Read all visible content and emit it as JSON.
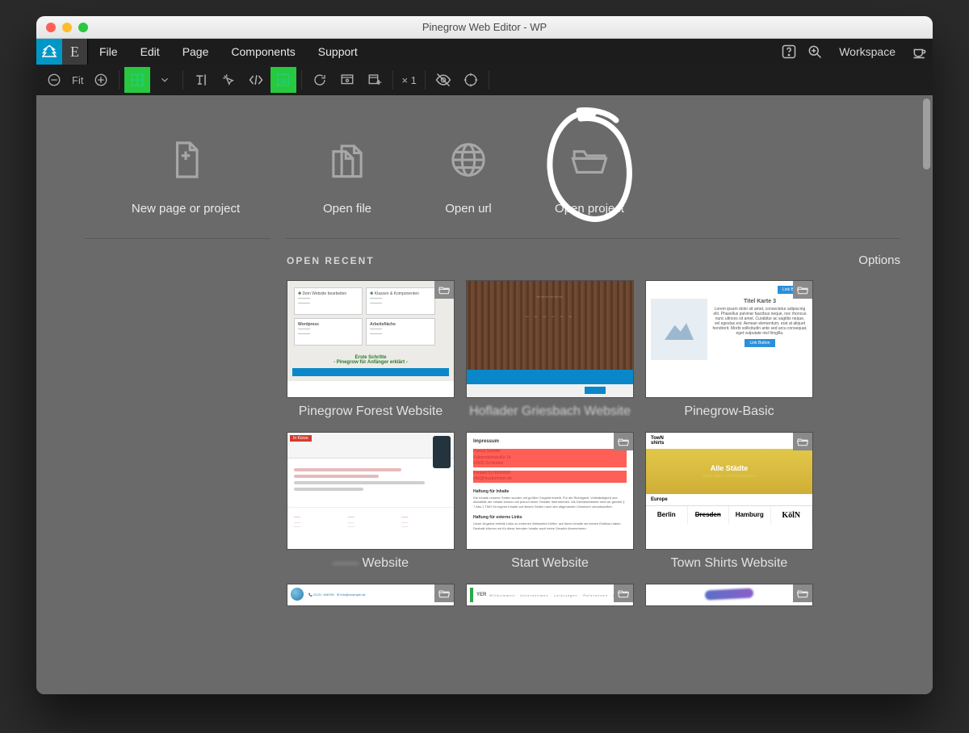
{
  "window": {
    "title": "Pinegrow Web Editor - WP"
  },
  "menubar": {
    "logo_letter": "E",
    "items": [
      "File",
      "Edit",
      "Page",
      "Components",
      "Support"
    ],
    "workspace": "Workspace"
  },
  "toolbar": {
    "fit": "Fit",
    "mult": "× 1"
  },
  "start": {
    "actions": {
      "new": "New page or project",
      "open_file": "Open file",
      "open_url": "Open url",
      "open_project": "Open project"
    },
    "recent_label": "OPEN RECENT",
    "options": "Options",
    "recent": [
      {
        "caption": "Pinegrow Forest Website"
      },
      {
        "caption": "Hoflader Griesbach Website"
      },
      {
        "caption": "Pinegrow-Basic"
      },
      {
        "caption": "Website"
      },
      {
        "caption": "Start Website"
      },
      {
        "caption": "Town Shirts Website"
      }
    ]
  },
  "thumb3": {
    "title": "Titel Karte 3",
    "btn": "Link Button"
  },
  "thumb5": {
    "impressum": "Impressum",
    "haftung_inhalte": "Haftung für Inhalte",
    "haftung_links": "Haftung für externe Links"
  },
  "thumb6": {
    "brand": "TowN\nshirts",
    "hero": "Alle Städte",
    "europe": "Europe",
    "cities": [
      "Berlin",
      "Dresden",
      "Hamburg",
      "KölN"
    ]
  },
  "thumb1": {
    "erste": "Erste Schritte",
    "sub": "- Pinegrow für Anfänger erklärt -"
  }
}
